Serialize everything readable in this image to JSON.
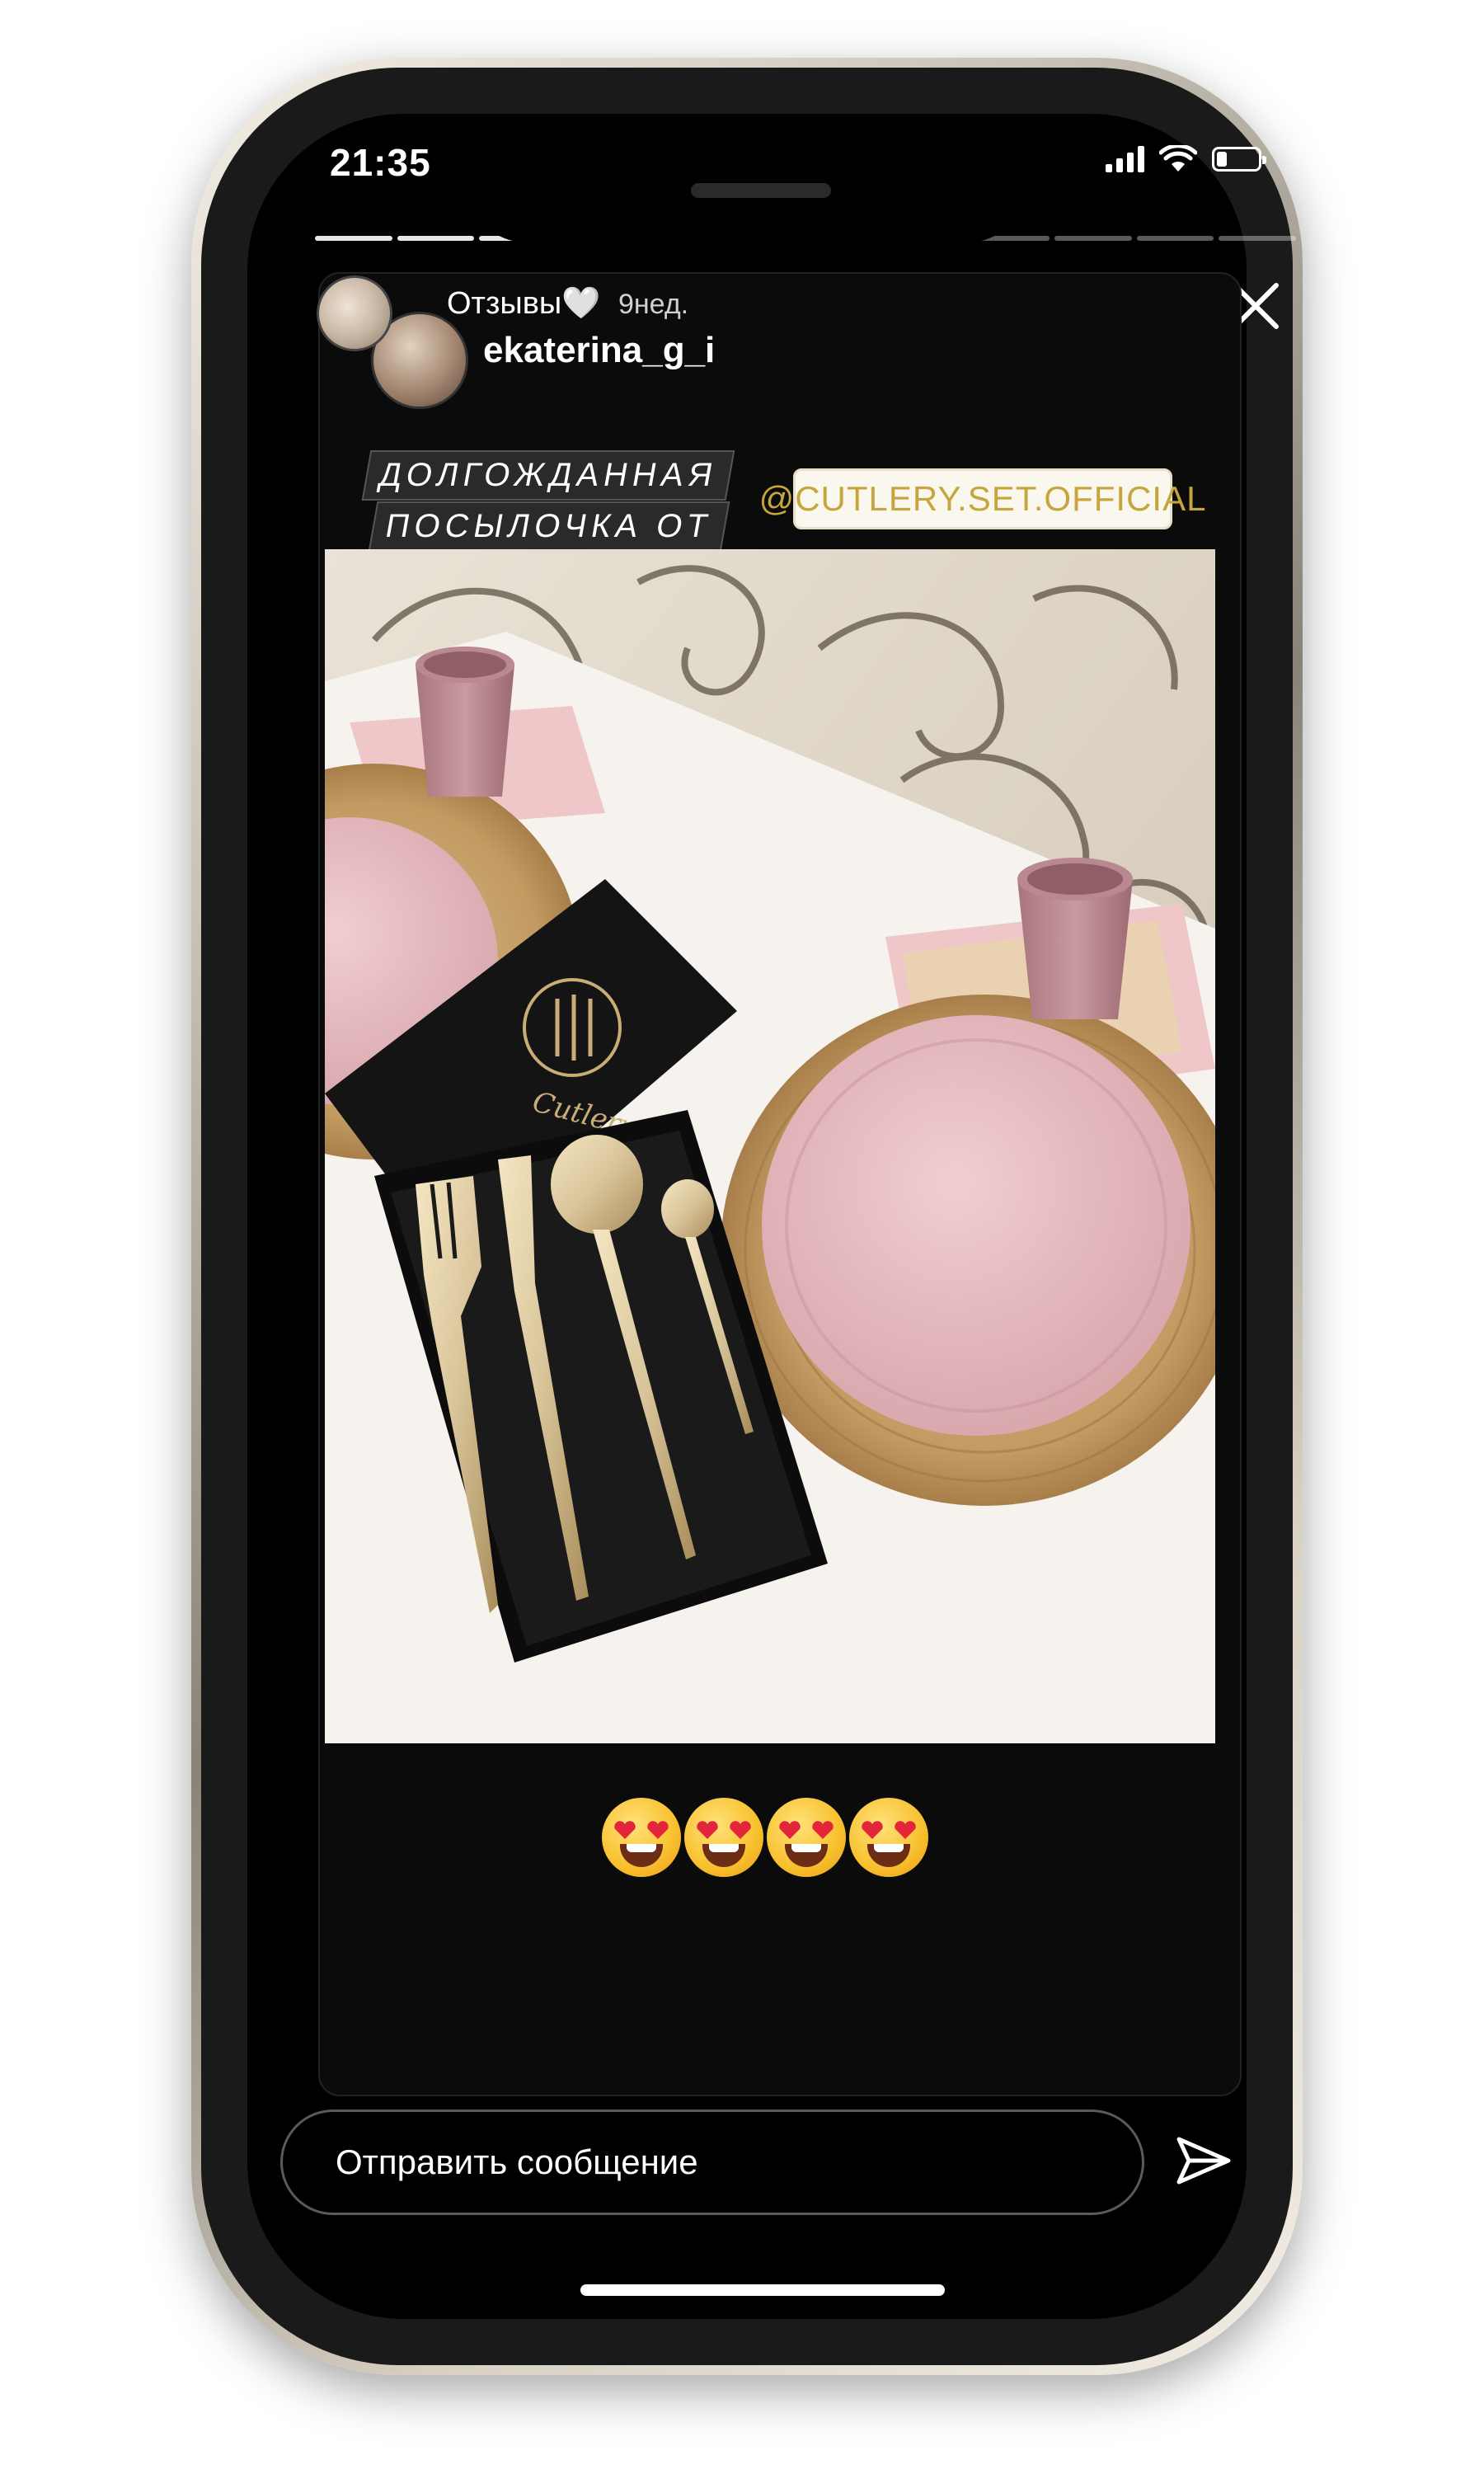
{
  "status_bar": {
    "time": "21:35",
    "signal_icon": "cellular-signal-icon",
    "wifi_icon": "wifi-icon",
    "battery_icon": "battery-icon",
    "battery_level": 0.25
  },
  "story": {
    "segments_total": 12,
    "segments_seen": 8,
    "highlight_name": "Отзывы",
    "highlight_heart": "🤍",
    "time_ago": "9нед.",
    "username": "ekaterina_g_i",
    "more_icon": "more-dots-icon",
    "close_icon": "close-icon"
  },
  "stickers": {
    "line1": "ДОЛГОЖДАННАЯ",
    "line2": "ПОСЫЛОЧКА ОТ",
    "mention": "@CUTLERY.SET.OFFICIAL"
  },
  "photo": {
    "box_logo_text": "Cutlery set"
  },
  "emojis": [
    "😍",
    "😍",
    "😍",
    "😍"
  ],
  "message_bar": {
    "placeholder": "Отправить сообщение",
    "send_icon": "send-paper-plane-icon"
  },
  "colors": {
    "background": "#000000",
    "mention_text": "#c7a53d",
    "plate_pink": "#e8bfc4",
    "gold": "#d9c49a"
  }
}
